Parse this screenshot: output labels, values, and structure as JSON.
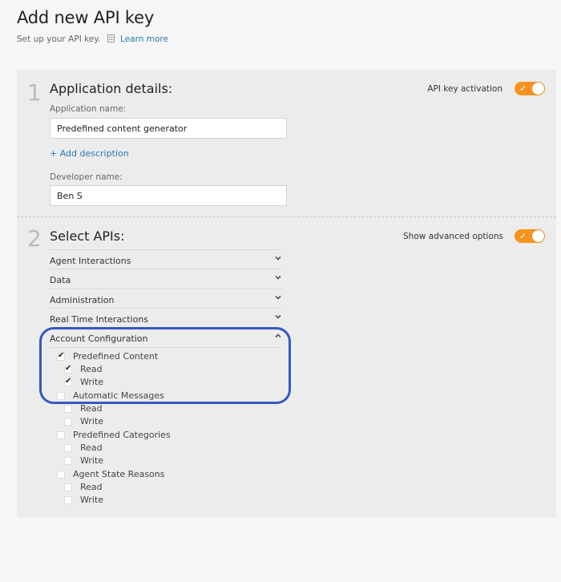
{
  "header": {
    "title": "Add new API key",
    "subtitle": "Set up your API key.",
    "learn_more": "Learn more"
  },
  "section1": {
    "number": "1",
    "title": "Application details:",
    "activation_label": "API key activation",
    "activation_on": true,
    "app_name_label": "Application name:",
    "app_name_value": "Predefined content generator",
    "add_description": "+ Add description",
    "dev_name_label": "Developer name:",
    "dev_name_value": "Ben S"
  },
  "section2": {
    "number": "2",
    "title": "Select APIs:",
    "advanced_label": "Show advanced options",
    "advanced_on": true,
    "categories": [
      {
        "label": "Agent Interactions",
        "expanded": false
      },
      {
        "label": "Data",
        "expanded": false
      },
      {
        "label": "Administration",
        "expanded": false
      },
      {
        "label": "Real Time Interactions",
        "expanded": false
      },
      {
        "label": "Account Configuration",
        "expanded": true
      }
    ],
    "permissions": [
      {
        "label": "Predefined Content",
        "checked": true,
        "read": {
          "label": "Read",
          "checked": true
        },
        "write": {
          "label": "Write",
          "checked": true
        }
      },
      {
        "label": "Automatic Messages",
        "checked": false,
        "read": {
          "label": "Read",
          "checked": false
        },
        "write": {
          "label": "Write",
          "checked": false
        }
      },
      {
        "label": "Predefined Categories",
        "checked": false,
        "read": {
          "label": "Read",
          "checked": false
        },
        "write": {
          "label": "Write",
          "checked": false
        }
      },
      {
        "label": "Agent State Reasons",
        "checked": false,
        "read": {
          "label": "Read",
          "checked": false
        },
        "write": {
          "label": "Write",
          "checked": false
        }
      }
    ]
  },
  "colors": {
    "accent_toggle": "#f7931e",
    "link": "#2a79b5",
    "highlight_outline": "#3558c2"
  }
}
